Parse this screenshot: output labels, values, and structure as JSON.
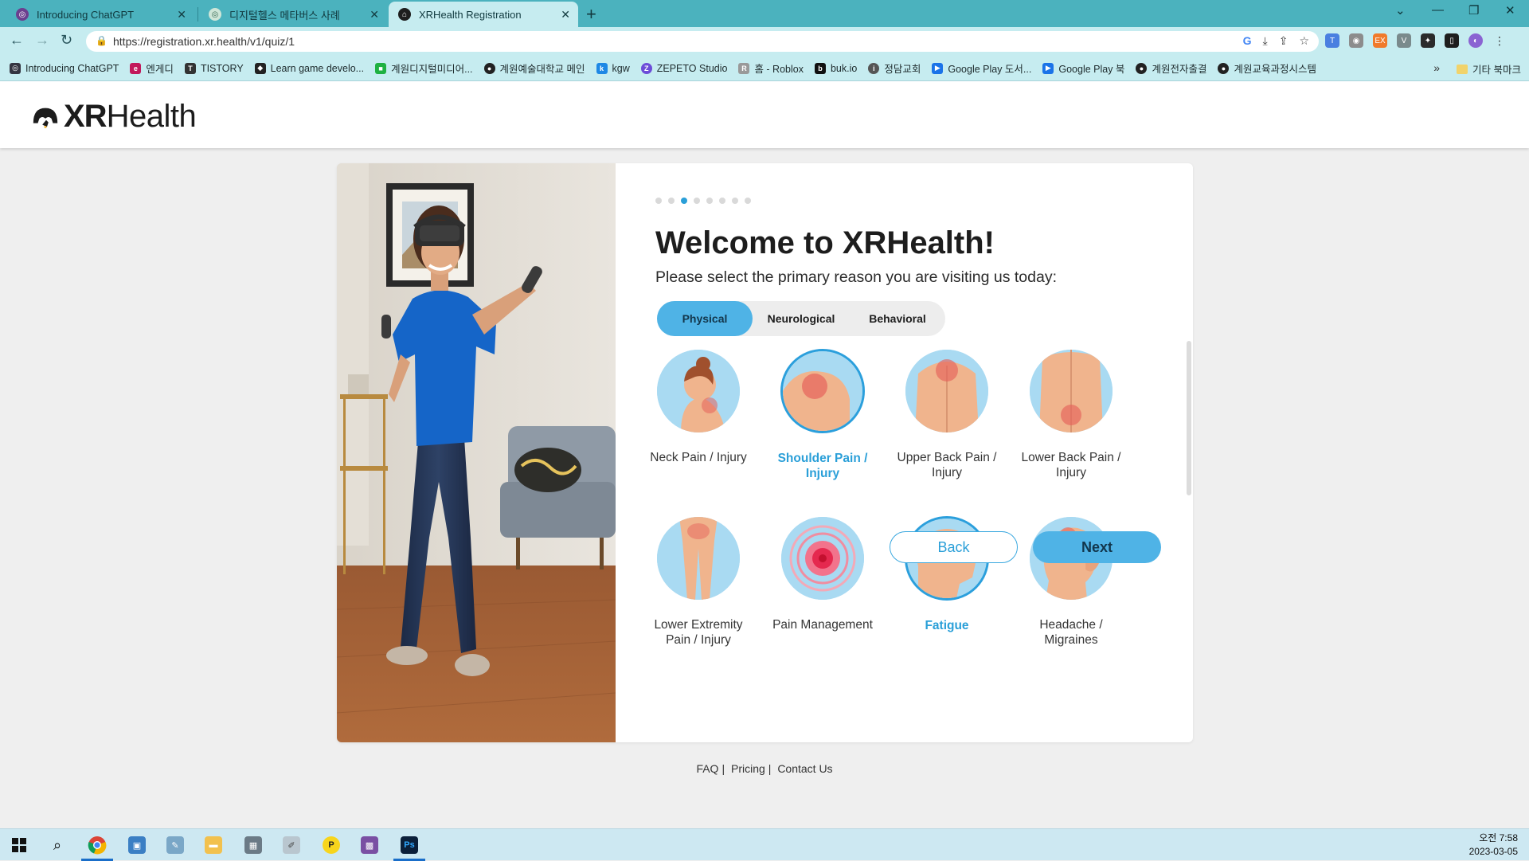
{
  "browser": {
    "tabs": [
      {
        "title": "Introducing ChatGPT",
        "icon": "openai-icon"
      },
      {
        "title": "디지털헬스 메타버스 사례",
        "icon": "openai-icon"
      },
      {
        "title": "XRHealth Registration",
        "icon": "xrhealth-icon"
      }
    ],
    "url": "https://registration.xr.health/v1/quiz/1",
    "bookmarks": [
      {
        "label": "Introducing ChatGPT",
        "color": "#343541"
      },
      {
        "label": "엔게디",
        "color": "#c2185b"
      },
      {
        "label": "TISTORY",
        "color": "#333333"
      },
      {
        "label": "Learn game develo...",
        "color": "#222222"
      },
      {
        "label": "계원디지털미디어...",
        "color": "#1fb141"
      },
      {
        "label": "계원예술대학교 메인",
        "color": "#222222"
      },
      {
        "label": "kgw",
        "color": "#1e88e5"
      },
      {
        "label": "ZEPETO Studio",
        "color": "#6c4cd8"
      },
      {
        "label": "홈 - Roblox",
        "color": "#999999"
      },
      {
        "label": "buk.io",
        "color": "#111111"
      },
      {
        "label": "정담교회",
        "color": "#555555"
      },
      {
        "label": "Google Play 도서...",
        "color": "#1a73e8"
      },
      {
        "label": "Google Play 북",
        "color": "#1a73e8"
      },
      {
        "label": "계원전자출결",
        "color": "#222222"
      },
      {
        "label": "계원교육과정시스템",
        "color": "#222222"
      }
    ],
    "bookmarks_overflow": "»",
    "other_bookmarks": "기타 북마크"
  },
  "site": {
    "logo_bold": "XR",
    "logo_light": "Health"
  },
  "quiz": {
    "progress_total": 8,
    "progress_current": 3,
    "title": "Welcome to XRHealth!",
    "subtitle": "Please select the primary reason you are visiting us today:",
    "categories": [
      {
        "label": "Physical",
        "selected": true
      },
      {
        "label": "Neurological",
        "selected": false
      },
      {
        "label": "Behavioral",
        "selected": false
      }
    ],
    "options": [
      {
        "line1": "Neck Pain / Injury",
        "line2": "",
        "selected": false
      },
      {
        "line1": "Shoulder Pain /",
        "line2": "Injury",
        "selected": true
      },
      {
        "line1": "Upper Back Pain /",
        "line2": "Injury",
        "selected": false
      },
      {
        "line1": "Lower Back Pain /",
        "line2": "Injury",
        "selected": false
      },
      {
        "line1": "Lower Extremity",
        "line2": "Pain / Injury",
        "selected": false
      },
      {
        "line1": "Pain Management",
        "line2": "",
        "selected": false
      },
      {
        "line1": "Fatigue",
        "line2": "",
        "selected": true
      },
      {
        "line1": "Headache /",
        "line2": "Migraines",
        "selected": false
      }
    ],
    "back_label": "Back",
    "next_label": "Next"
  },
  "footer": {
    "faq": "FAQ",
    "pricing": "Pricing",
    "contact": "Contact Us",
    "sep": "|"
  },
  "taskbar": {
    "time_line1": "오전 7:58",
    "time_line2": "2023-03-05"
  },
  "colors": {
    "accent": "#4fb3e6",
    "accent_text": "#2a9fd8",
    "tab_bar": "#4bb2be",
    "toolbar": "#c6ecf0"
  }
}
